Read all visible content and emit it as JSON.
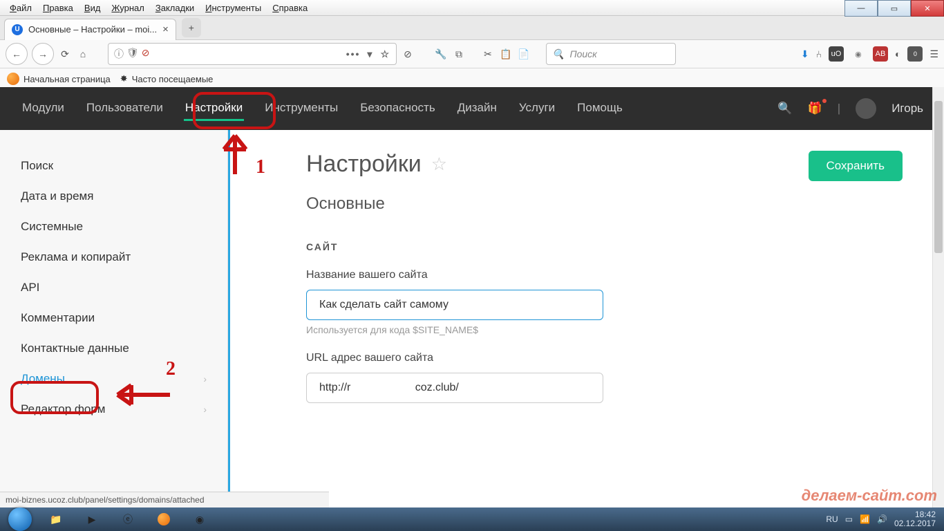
{
  "os_menu": [
    "Файл",
    "Правка",
    "Вид",
    "Журнал",
    "Закладки",
    "Инструменты",
    "Справка"
  ],
  "tab": {
    "title": "Основные – Настройки – moi..."
  },
  "search_placeholder": "Поиск",
  "bookmarks": [
    {
      "label": "Начальная страница"
    },
    {
      "label": "Часто посещаемые"
    }
  ],
  "topnav": {
    "items": [
      "Модули",
      "Пользователи",
      "Настройки",
      "Инструменты",
      "Безопасность",
      "Дизайн",
      "Услуги",
      "Помощь"
    ],
    "active_index": 2,
    "user": "Игорь"
  },
  "sidebar": {
    "items": [
      {
        "label": "Поиск"
      },
      {
        "label": "Дата и время"
      },
      {
        "label": "Системные"
      },
      {
        "label": "Реклама и копирайт"
      },
      {
        "label": "API"
      },
      {
        "label": "Комментарии"
      },
      {
        "label": "Контактные данные"
      },
      {
        "label": "Домены",
        "chevron": true,
        "highlight": true
      },
      {
        "label": "Редактор форм",
        "chevron": true
      }
    ]
  },
  "page": {
    "title": "Настройки",
    "subtitle": "Основные",
    "save": "Сохранить",
    "section": "САЙТ",
    "fld1_label": "Название вашего сайта",
    "fld1_value": "Как сделать сайт самому",
    "fld1_hint": "Используется для кода $SITE_NAME$",
    "fld2_label": "URL адрес вашего сайта",
    "fld2_value": "http://r                     coz.club/"
  },
  "annotations": {
    "n1": "1",
    "n2": "2"
  },
  "status": "moi-biznes.ucoz.club/panel/settings/domains/attached",
  "tray": {
    "lang": "RU",
    "time": "18:42",
    "date": "02.12.2017"
  },
  "watermark": "делаем-сайт.com"
}
